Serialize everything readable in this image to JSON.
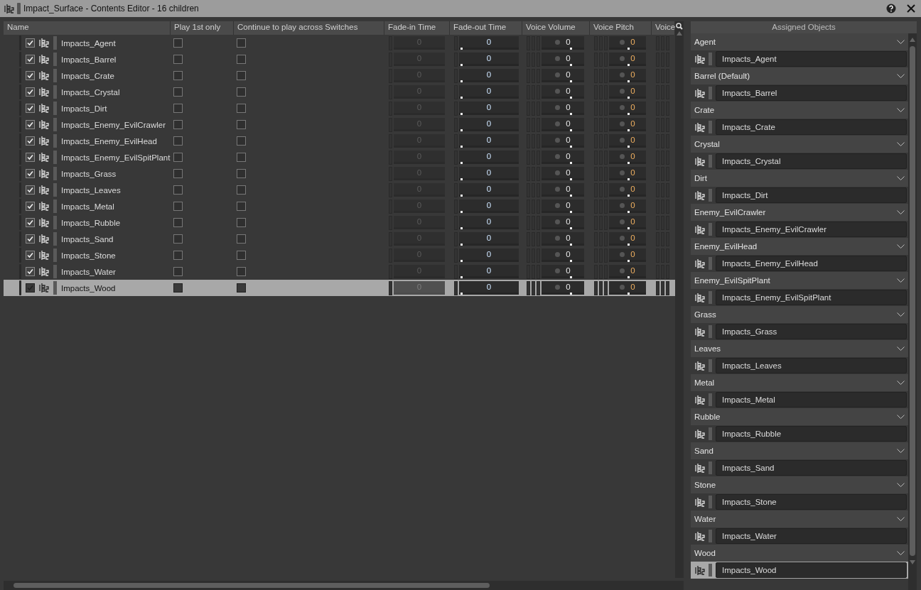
{
  "window": {
    "title": "Impact_Surface - Contents Editor - 16 children"
  },
  "table": {
    "columns": [
      {
        "label": "Name",
        "kind": "name"
      },
      {
        "label": "Play 1st only",
        "kind": "check"
      },
      {
        "label": "Continue to play across Switches",
        "kind": "check"
      },
      {
        "label": "Fade-in Time",
        "kind": "disabled_number"
      },
      {
        "label": "Fade-out Time",
        "kind": "number"
      },
      {
        "label": "Voice Volume",
        "kind": "dial"
      },
      {
        "label": "Voice Pitch",
        "kind": "pitch"
      },
      {
        "label": "Voice",
        "kind": "cut"
      }
    ],
    "rows": [
      {
        "name": "Impacts_Agent",
        "enabled": true,
        "play_first_only": false,
        "continue_across_switches": false,
        "values": [
          "0",
          "0",
          "0",
          "0"
        ],
        "selected": false
      },
      {
        "name": "Impacts_Barrel",
        "enabled": true,
        "play_first_only": false,
        "continue_across_switches": false,
        "values": [
          "0",
          "0",
          "0",
          "0"
        ],
        "selected": false
      },
      {
        "name": "Impacts_Crate",
        "enabled": true,
        "play_first_only": false,
        "continue_across_switches": false,
        "values": [
          "0",
          "0",
          "0",
          "0"
        ],
        "selected": false
      },
      {
        "name": "Impacts_Crystal",
        "enabled": true,
        "play_first_only": false,
        "continue_across_switches": false,
        "values": [
          "0",
          "0",
          "0",
          "0"
        ],
        "selected": false
      },
      {
        "name": "Impacts_Dirt",
        "enabled": true,
        "play_first_only": false,
        "continue_across_switches": false,
        "values": [
          "0",
          "0",
          "0",
          "0"
        ],
        "selected": false
      },
      {
        "name": "Impacts_Enemy_EvilCrawler",
        "enabled": true,
        "play_first_only": false,
        "continue_across_switches": false,
        "values": [
          "0",
          "0",
          "0",
          "0"
        ],
        "selected": false
      },
      {
        "name": "Impacts_Enemy_EvilHead",
        "enabled": true,
        "play_first_only": false,
        "continue_across_switches": false,
        "values": [
          "0",
          "0",
          "0",
          "0"
        ],
        "selected": false
      },
      {
        "name": "Impacts_Enemy_EvilSpitPlant",
        "enabled": true,
        "play_first_only": false,
        "continue_across_switches": false,
        "values": [
          "0",
          "0",
          "0",
          "0"
        ],
        "selected": false
      },
      {
        "name": "Impacts_Grass",
        "enabled": true,
        "play_first_only": false,
        "continue_across_switches": false,
        "values": [
          "0",
          "0",
          "0",
          "0"
        ],
        "selected": false
      },
      {
        "name": "Impacts_Leaves",
        "enabled": true,
        "play_first_only": false,
        "continue_across_switches": false,
        "values": [
          "0",
          "0",
          "0",
          "0"
        ],
        "selected": false
      },
      {
        "name": "Impacts_Metal",
        "enabled": true,
        "play_first_only": false,
        "continue_across_switches": false,
        "values": [
          "0",
          "0",
          "0",
          "0"
        ],
        "selected": false
      },
      {
        "name": "Impacts_Rubble",
        "enabled": true,
        "play_first_only": false,
        "continue_across_switches": false,
        "values": [
          "0",
          "0",
          "0",
          "0"
        ],
        "selected": false
      },
      {
        "name": "Impacts_Sand",
        "enabled": true,
        "play_first_only": false,
        "continue_across_switches": false,
        "values": [
          "0",
          "0",
          "0",
          "0"
        ],
        "selected": false
      },
      {
        "name": "Impacts_Stone",
        "enabled": true,
        "play_first_only": false,
        "continue_across_switches": false,
        "values": [
          "0",
          "0",
          "0",
          "0"
        ],
        "selected": false
      },
      {
        "name": "Impacts_Water",
        "enabled": true,
        "play_first_only": false,
        "continue_across_switches": false,
        "values": [
          "0",
          "0",
          "0",
          "0"
        ],
        "selected": false
      },
      {
        "name": "Impacts_Wood",
        "enabled": true,
        "play_first_only": false,
        "continue_across_switches": false,
        "values": [
          "0",
          "0",
          "0",
          "0"
        ],
        "selected": true
      }
    ]
  },
  "assigned_objects": {
    "title": "Assigned Objects",
    "groups": [
      {
        "label": "Agent",
        "object": "Impacts_Agent",
        "selected": false
      },
      {
        "label": "Barrel (Default)",
        "object": "Impacts_Barrel",
        "selected": false
      },
      {
        "label": "Crate",
        "object": "Impacts_Crate",
        "selected": false
      },
      {
        "label": "Crystal",
        "object": "Impacts_Crystal",
        "selected": false
      },
      {
        "label": "Dirt",
        "object": "Impacts_Dirt",
        "selected": false
      },
      {
        "label": "Enemy_EvilCrawler",
        "object": "Impacts_Enemy_EvilCrawler",
        "selected": false
      },
      {
        "label": "Enemy_EvilHead",
        "object": "Impacts_Enemy_EvilHead",
        "selected": false
      },
      {
        "label": "Enemy_EvilSpitPlant",
        "object": "Impacts_Enemy_EvilSpitPlant",
        "selected": false
      },
      {
        "label": "Grass",
        "object": "Impacts_Grass",
        "selected": false
      },
      {
        "label": "Leaves",
        "object": "Impacts_Leaves",
        "selected": false
      },
      {
        "label": "Metal",
        "object": "Impacts_Metal",
        "selected": false
      },
      {
        "label": "Rubble",
        "object": "Impacts_Rubble",
        "selected": false
      },
      {
        "label": "Sand",
        "object": "Impacts_Sand",
        "selected": false
      },
      {
        "label": "Stone",
        "object": "Impacts_Stone",
        "selected": false
      },
      {
        "label": "Water",
        "object": "Impacts_Water",
        "selected": false
      },
      {
        "label": "Wood",
        "object": "Impacts_Wood",
        "selected": true
      }
    ]
  }
}
